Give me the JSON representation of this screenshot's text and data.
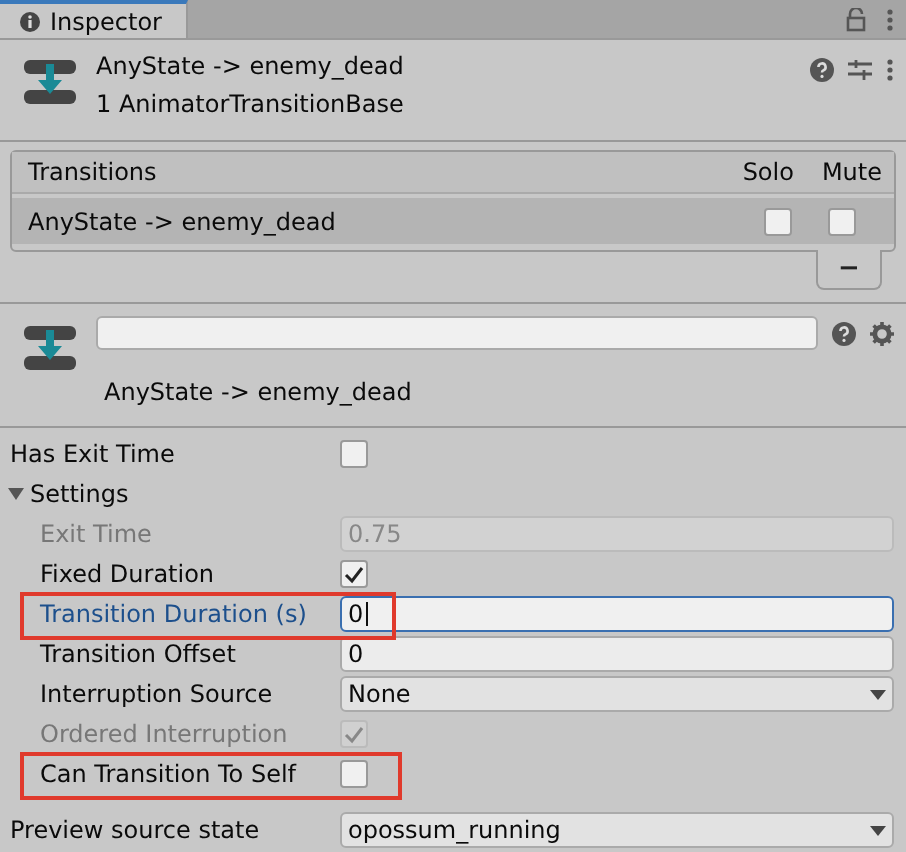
{
  "tab": {
    "title": "Inspector",
    "selected": true
  },
  "header": {
    "title": "AnyState -> enemy_dead",
    "subtitle": "1 AnimatorTransitionBase"
  },
  "transitions": {
    "columns": [
      "Transitions",
      "Solo",
      "Mute"
    ],
    "rows": [
      {
        "name": "AnyState -> enemy_dead",
        "selected": true,
        "solo": false,
        "mute": false
      }
    ],
    "remove_button": "−"
  },
  "transition": {
    "label": "AnyState -> enemy_dead"
  },
  "properties": [
    {
      "kind": "checkbox",
      "label": "Has Exit Time",
      "checked": false,
      "disabled": false,
      "highlighted": false
    },
    {
      "kind": "group",
      "label": "Settings",
      "expanded": true,
      "children": [
        {
          "kind": "number",
          "label": "Exit Time",
          "value": "0.75",
          "disabled": true,
          "focused": false,
          "highlighted": false
        },
        {
          "kind": "checkbox",
          "label": "Fixed Duration",
          "checked": true,
          "disabled": false,
          "highlighted": false
        },
        {
          "kind": "number",
          "label": "Transition Duration (s)",
          "value": "0",
          "disabled": false,
          "focused": true,
          "highlighted": true
        },
        {
          "kind": "number",
          "label": "Transition Offset",
          "value": "0",
          "disabled": false,
          "focused": false,
          "highlighted": false
        },
        {
          "kind": "dropdown",
          "label": "Interruption Source",
          "value": "None",
          "disabled": false,
          "highlighted": false
        },
        {
          "kind": "checkbox",
          "label": "Ordered Interruption",
          "checked": true,
          "disabled": true,
          "highlighted": false
        },
        {
          "kind": "checkbox",
          "label": "Can Transition To Self",
          "checked": false,
          "disabled": false,
          "highlighted": true
        }
      ]
    }
  ],
  "preview": {
    "kind": "dropdown",
    "label": "Preview source state",
    "value": "opossum_running",
    "disabled": false,
    "highlighted": false
  }
}
